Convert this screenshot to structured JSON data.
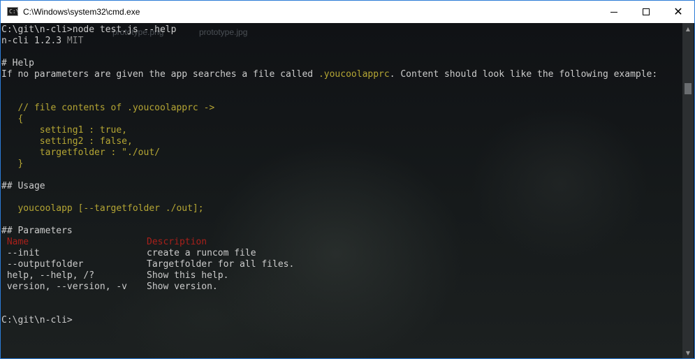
{
  "window": {
    "title": "C:\\Windows\\system32\\cmd.exe",
    "icon_text": "C:\\",
    "buttons": {
      "minimize": "minimize",
      "maximize": "maximize",
      "close": "✕"
    }
  },
  "background_files": [
    "prototype.png",
    "prototype.jpg"
  ],
  "console": {
    "prompt_command": "C:\\git\\n-cli>node test.js --help",
    "version_name": "n-cli 1.2.3",
    "version_license": "MIT",
    "help_heading": "# Help",
    "intro_before": "If no parameters are given the app searches a file called ",
    "intro_file": ".youcoolapprc",
    "intro_after": ". Content should look like the following example:",
    "example": [
      "   // file contents of .youcoolapprc ->",
      "   {",
      "       setting1 : true,",
      "       setting2 : false,",
      "       targetfolder : \"./out/",
      "   }"
    ],
    "usage_heading": "## Usage",
    "usage_line": "   youcoolapp [--targetfolder ./out];",
    "params_heading": "## Parameters",
    "params_header": {
      "name": " Name",
      "description": "Description"
    },
    "params": [
      {
        "name": " --init",
        "description": "create a runcom file"
      },
      {
        "name": " --outputfolder",
        "description": "Targetfolder for all files."
      },
      {
        "name": " help, --help, /?",
        "description": "Show this help."
      },
      {
        "name": " version, --version, -v",
        "description": "Show version."
      }
    ],
    "final_prompt": "C:\\git\\n-cli>"
  },
  "colors": {
    "title_bar": "#ffffff",
    "window_border": "#2b7bd6",
    "console_text": "#cccccc",
    "highlight_yellow": "#b5a634",
    "header_red": "#a8201a"
  }
}
